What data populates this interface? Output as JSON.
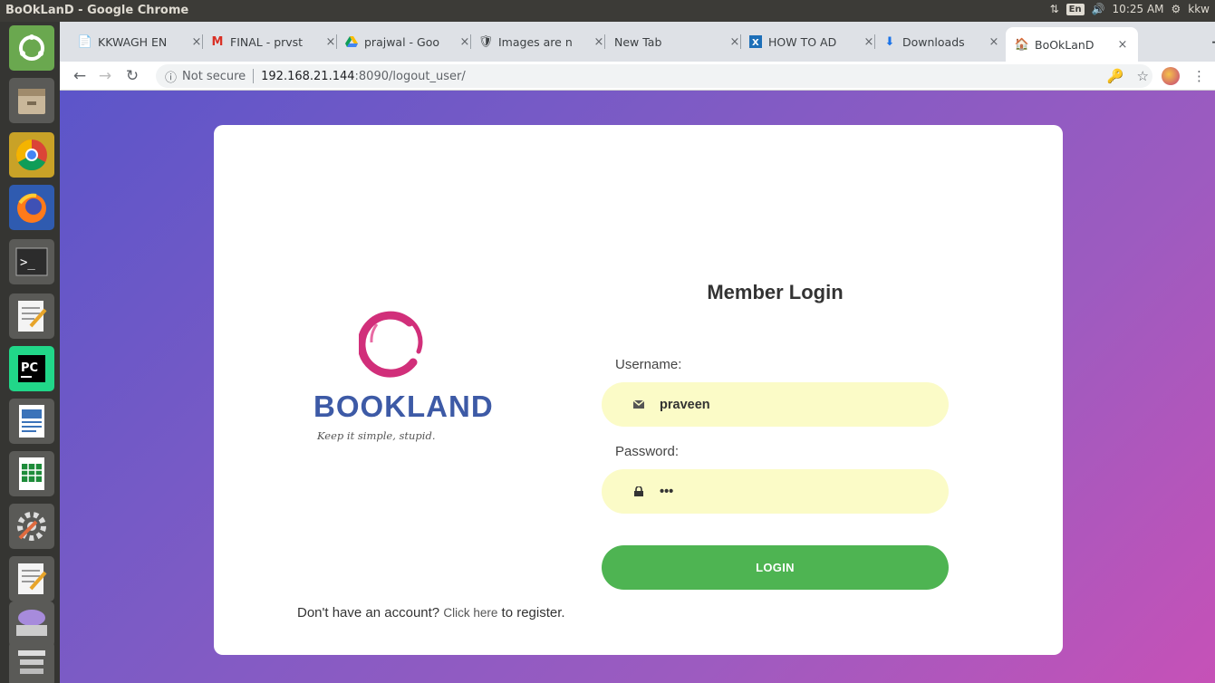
{
  "window": {
    "title": "BoOkLanD - Google Chrome",
    "input_lang": "En",
    "time": "10:25 AM",
    "user": "kkw"
  },
  "launcher": {
    "icons": [
      "ubuntu-dash-icon",
      "files-icon",
      "chrome-icon",
      "firefox-icon",
      "terminal-icon",
      "text-editor-icon",
      "pycharm-icon",
      "writer-icon",
      "calc-icon",
      "system-settings-icon",
      "gedit-icon",
      "dvd-drive-icon",
      "trash-icon"
    ]
  },
  "browser": {
    "tabs": [
      {
        "title": "KKWAGH EN",
        "icon": "document-icon"
      },
      {
        "title": "FINAL - prvst",
        "icon": "gmail-icon"
      },
      {
        "title": "prajwal - Goo",
        "icon": "google-drive-icon"
      },
      {
        "title": "Images are n",
        "icon": "extension-icon"
      },
      {
        "title": "New Tab",
        "icon": ""
      },
      {
        "title": "HOW TO AD",
        "icon": "excel-icon"
      },
      {
        "title": "Downloads",
        "icon": "download-icon"
      },
      {
        "title": "BoOkLanD",
        "icon": "home-icon"
      }
    ],
    "address": {
      "security": "Not secure",
      "host": "192.168.21.144",
      "path": ":8090/logout_user/"
    }
  },
  "page": {
    "logo": {
      "brand": "BOOKLAND",
      "tagline": "Keep it simple, stupid.",
      "ring_color": "#d12f7a"
    },
    "heading": "Member Login",
    "username_label": "Username:",
    "username_value": "praveen",
    "password_label": "Password:",
    "password_value": "•••",
    "login_button": "LOGIN",
    "register_prefix": "Don't have an account?",
    "register_link": "Click here",
    "register_suffix": "to register.",
    "colors": {
      "button": "#4eb452",
      "field_bg": "#fbfbc7",
      "brand": "#3d5aa6"
    }
  }
}
